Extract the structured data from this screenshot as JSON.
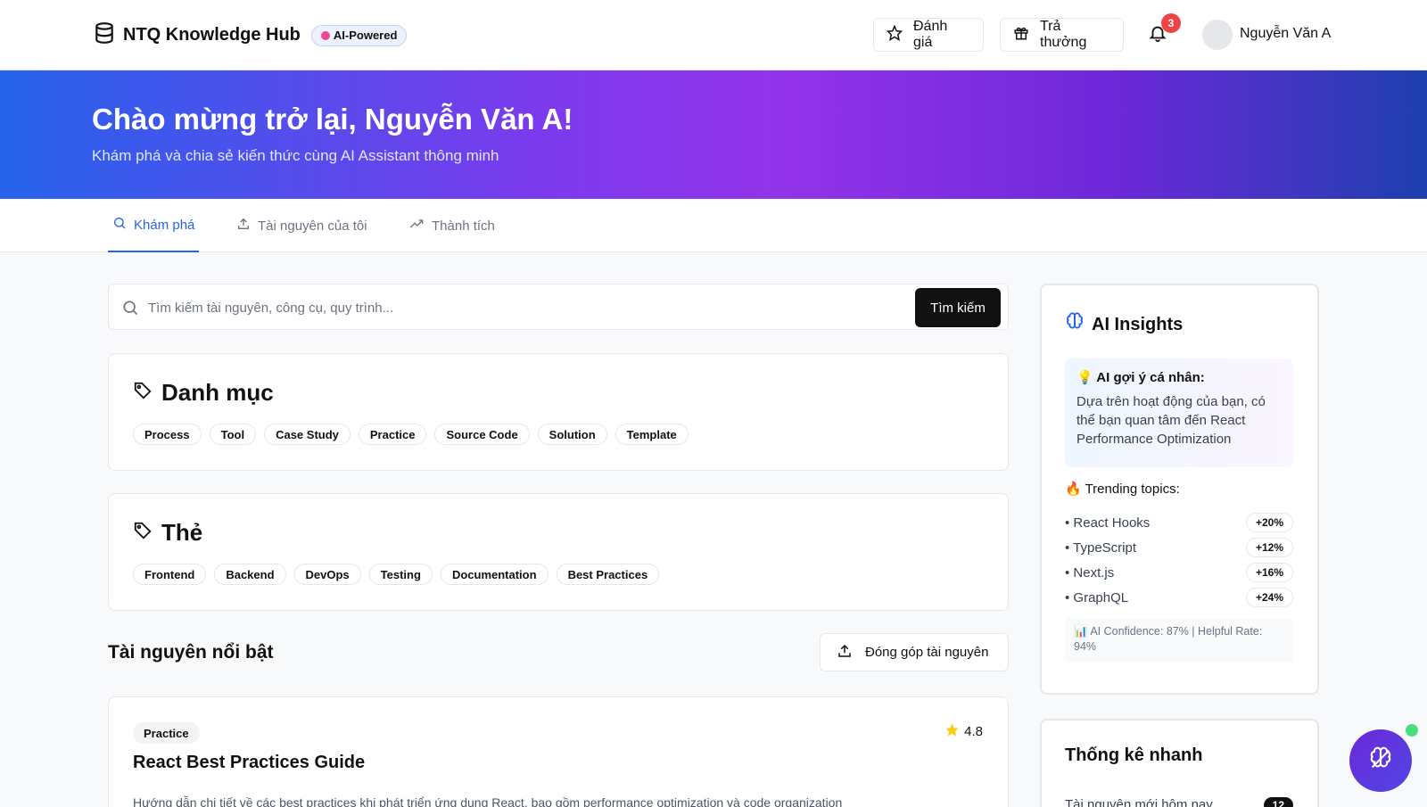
{
  "header": {
    "brand": "NTQ Knowledge Hub",
    "ai_badge": "AI-Powered",
    "review_label": "Đánh giá",
    "reward_label": "Trả thưởng",
    "notification_count": "3",
    "user_name": "Nguyễn Văn A"
  },
  "hero": {
    "title": "Chào mừng trở lại, Nguyễn Văn A!",
    "subtitle": "Khám phá và chia sẻ kiến thức cùng AI Assistant thông minh"
  },
  "tabs": [
    {
      "label": "Khám phá",
      "active": true
    },
    {
      "label": "Tài nguyên của tôi",
      "active": false
    },
    {
      "label": "Thành tích",
      "active": false
    }
  ],
  "search": {
    "placeholder": "Tìm kiếm tài nguyên, công cụ, quy trình...",
    "value": "",
    "button": "Tìm kiếm"
  },
  "categories": {
    "title": "Danh mục",
    "items": [
      "Process",
      "Tool",
      "Case Study",
      "Practice",
      "Source Code",
      "Solution",
      "Template"
    ]
  },
  "tags": {
    "title": "Thẻ",
    "items": [
      "Frontend",
      "Backend",
      "DevOps",
      "Testing",
      "Documentation",
      "Best Practices"
    ]
  },
  "featured": {
    "title": "Tài nguyên nổi bật",
    "contribute_label": "Đóng góp tài nguyên",
    "resources": [
      {
        "category": "Practice",
        "rating": "4.8",
        "title": "React Best Practices Guide",
        "description": "Hướng dẫn chi tiết về các best practices khi phát triển ứng dụng React, bao gồm performance optimization và code organization"
      }
    ]
  },
  "insights": {
    "title": "AI Insights",
    "suggest_title": "💡 AI gợi ý cá nhân:",
    "suggest_body": "Dựa trên hoạt động của bạn, có thể bạn quan tâm đến React Performance Optimization",
    "trending_title": "🔥 Trending topics:",
    "trending": [
      {
        "topic": "• React Hooks",
        "change": "+20%"
      },
      {
        "topic": "• TypeScript",
        "change": "+12%"
      },
      {
        "topic": "• Next.js",
        "change": "+16%"
      },
      {
        "topic": "• GraphQL",
        "change": "+24%"
      }
    ],
    "confidence": "📊 AI Confidence: 87% | Helpful Rate: 94%"
  },
  "quick_stats": {
    "title": "Thống kê nhanh",
    "rows": [
      {
        "label": "Tài nguyên mới hôm nay",
        "value": "12"
      }
    ]
  },
  "colors": {
    "accent": "#2563eb",
    "notification": "#ef4444",
    "hero_start": "#2563eb",
    "hero_mid": "#9333ea",
    "hero_end": "#1e40af"
  }
}
